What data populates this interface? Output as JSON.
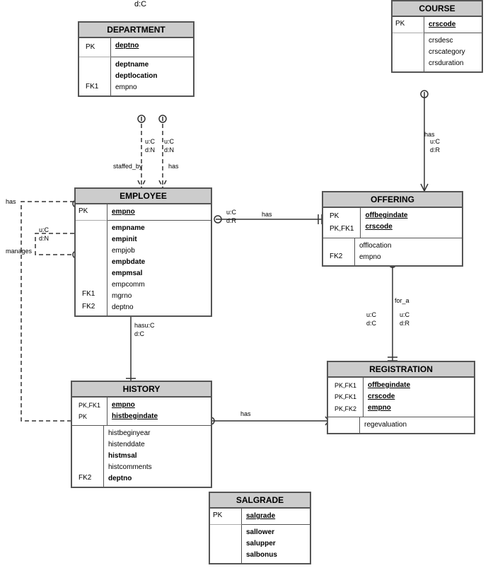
{
  "entities": {
    "department": {
      "title": "DEPARTMENT",
      "pk_key": "PK",
      "pk_field": "deptno",
      "fk_keys": [
        "",
        "FK1"
      ],
      "fields": [
        "deptname",
        "deptlocation",
        "empno"
      ]
    },
    "employee": {
      "title": "EMPLOYEE",
      "pk_key": "PK",
      "pk_field": "empno",
      "fk_keys": [
        "",
        "FK1",
        "FK2"
      ],
      "fields": [
        "empname",
        "empinit",
        "empjob",
        "empbdate",
        "empmsal",
        "empcomm",
        "mgrno",
        "deptno"
      ]
    },
    "course": {
      "title": "COURSE",
      "pk_key": "PK",
      "pk_field": "crscode",
      "fk_keys": [
        ""
      ],
      "fields": [
        "crsdesc",
        "crscategory",
        "crsduration"
      ]
    },
    "offering": {
      "title": "OFFERING",
      "pk_key_1": "PK",
      "pk_key_2": "PK,FK1",
      "pk_field_1": "offbegindate",
      "pk_field_2": "crscode",
      "fk_keys": [
        "FK2"
      ],
      "fields": [
        "offlocation",
        "empno"
      ]
    },
    "history": {
      "title": "HISTORY",
      "pk_key_1": "PK,FK1",
      "pk_key_2": "PK",
      "pk_field_1": "empno",
      "pk_field_2": "histbegindate",
      "fk_keys": [
        "",
        "FK2"
      ],
      "fields": [
        "histbeginyear",
        "histenddate",
        "histmsal",
        "histcomments",
        "deptno"
      ]
    },
    "registration": {
      "title": "REGISTRATION",
      "pk_key_1": "PK,FK1",
      "pk_key_2": "PK,FK1",
      "pk_key_3": "PK,FK2",
      "pk_field_1": "offbegindate",
      "pk_field_2": "crscode",
      "pk_field_3": "empno",
      "fk_keys": [
        ""
      ],
      "fields": [
        "regevaluation"
      ]
    },
    "salgrade": {
      "title": "SALGRADE",
      "pk_key": "PK",
      "pk_field": "salgrade",
      "fk_keys": [
        ""
      ],
      "fields": [
        "sallower",
        "salupper",
        "salbonus"
      ]
    }
  },
  "relationships": {
    "staffed_by": "staffed_by",
    "has_dept_emp": "has",
    "has_emp_offering": "has",
    "manages": "manages",
    "has_emp_history": "has",
    "for_a": "for_a",
    "has_history_reg": "has"
  },
  "cardinalities": {
    "uc": "u:C",
    "dn": "d:N",
    "dr": "d:R",
    "dc": "d:C",
    "hasu_c": "hasu:C"
  }
}
